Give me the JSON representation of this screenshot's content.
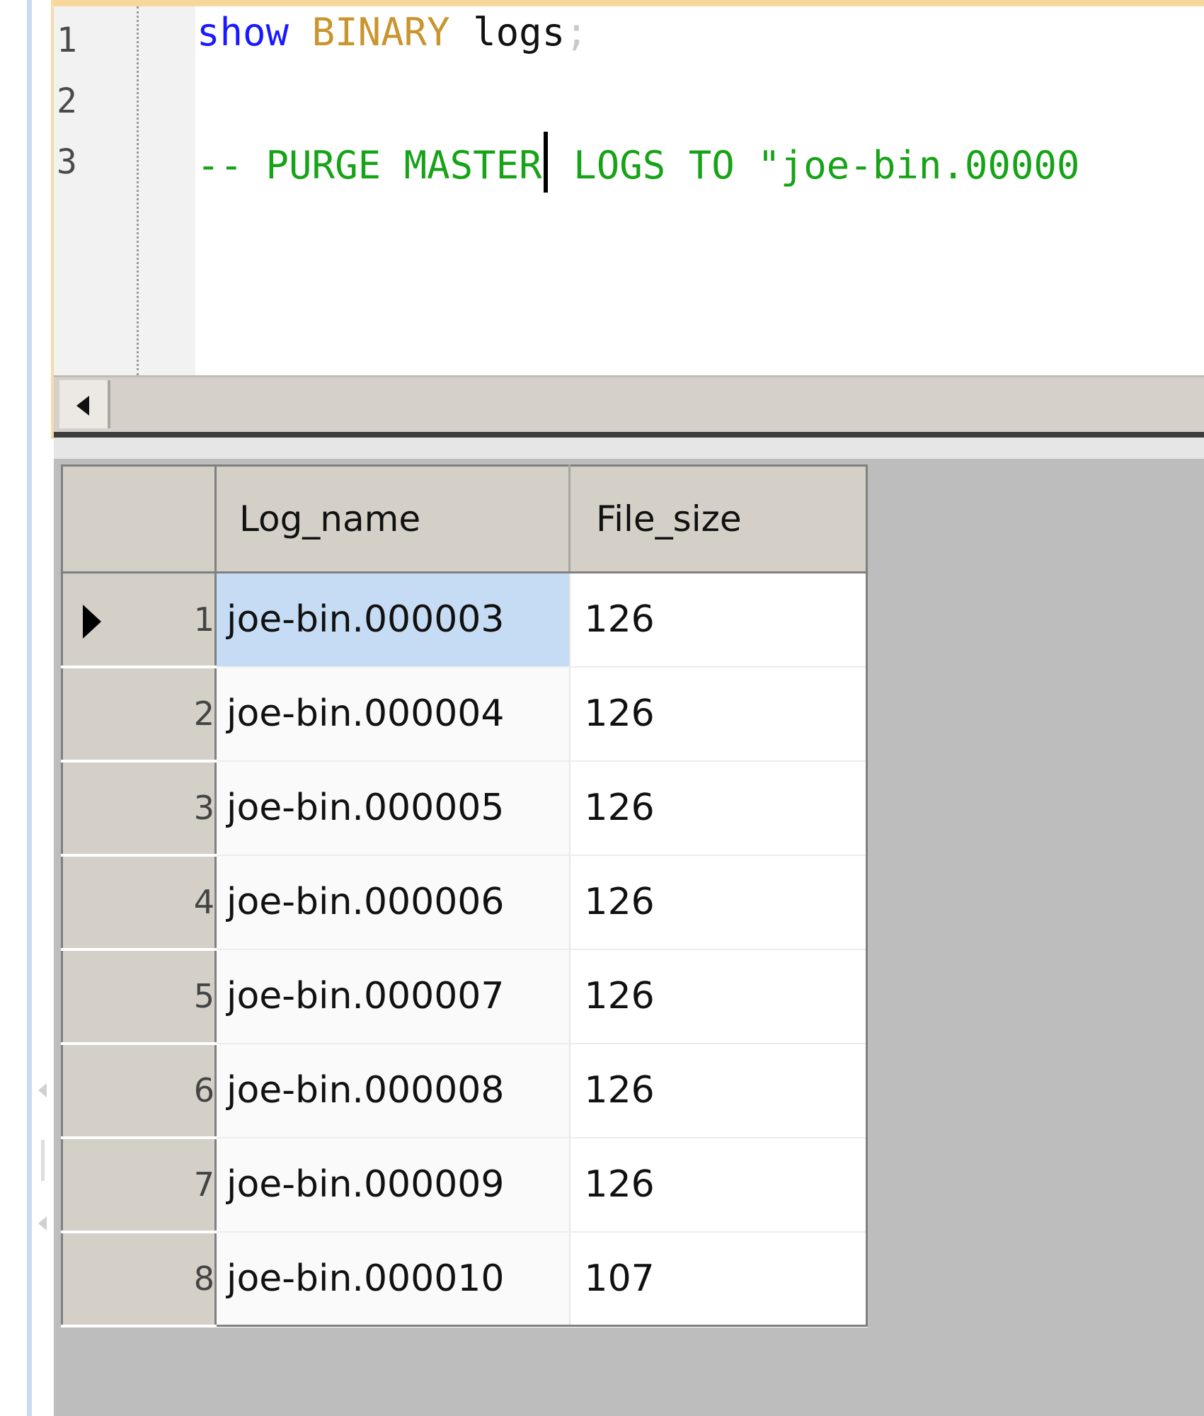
{
  "editor": {
    "line_numbers": [
      "1",
      "2",
      "3"
    ],
    "line1": {
      "kw1": "show",
      "kw2": "BINARY",
      "word": "logs",
      "punct": ";"
    },
    "line3": {
      "before_caret": "-- PURGE MASTER",
      "after_caret": " LOGS TO \"joe-bin.00000"
    }
  },
  "results": {
    "columns": [
      "Log_name",
      "File_size"
    ],
    "rows": [
      {
        "index": "1",
        "log_name": "joe-bin.000003",
        "file_size": "126"
      },
      {
        "index": "2",
        "log_name": "joe-bin.000004",
        "file_size": "126"
      },
      {
        "index": "3",
        "log_name": "joe-bin.000005",
        "file_size": "126"
      },
      {
        "index": "4",
        "log_name": "joe-bin.000006",
        "file_size": "126"
      },
      {
        "index": "5",
        "log_name": "joe-bin.000007",
        "file_size": "126"
      },
      {
        "index": "6",
        "log_name": "joe-bin.000008",
        "file_size": "126"
      },
      {
        "index": "7",
        "log_name": "joe-bin.000009",
        "file_size": "126"
      },
      {
        "index": "8",
        "log_name": "joe-bin.000010",
        "file_size": "107"
      }
    ]
  },
  "colors": {
    "keyword_blue": "#1a18ff",
    "keyword_orange": "#c9952e",
    "comment_green": "#17a317",
    "selection_blue": "#c6dcf5",
    "grid_header": "#d4d0c8",
    "results_background": "#bdbdbd"
  },
  "icons": {
    "scroll_left": "triangle-left",
    "current_row": "triangle-right"
  }
}
